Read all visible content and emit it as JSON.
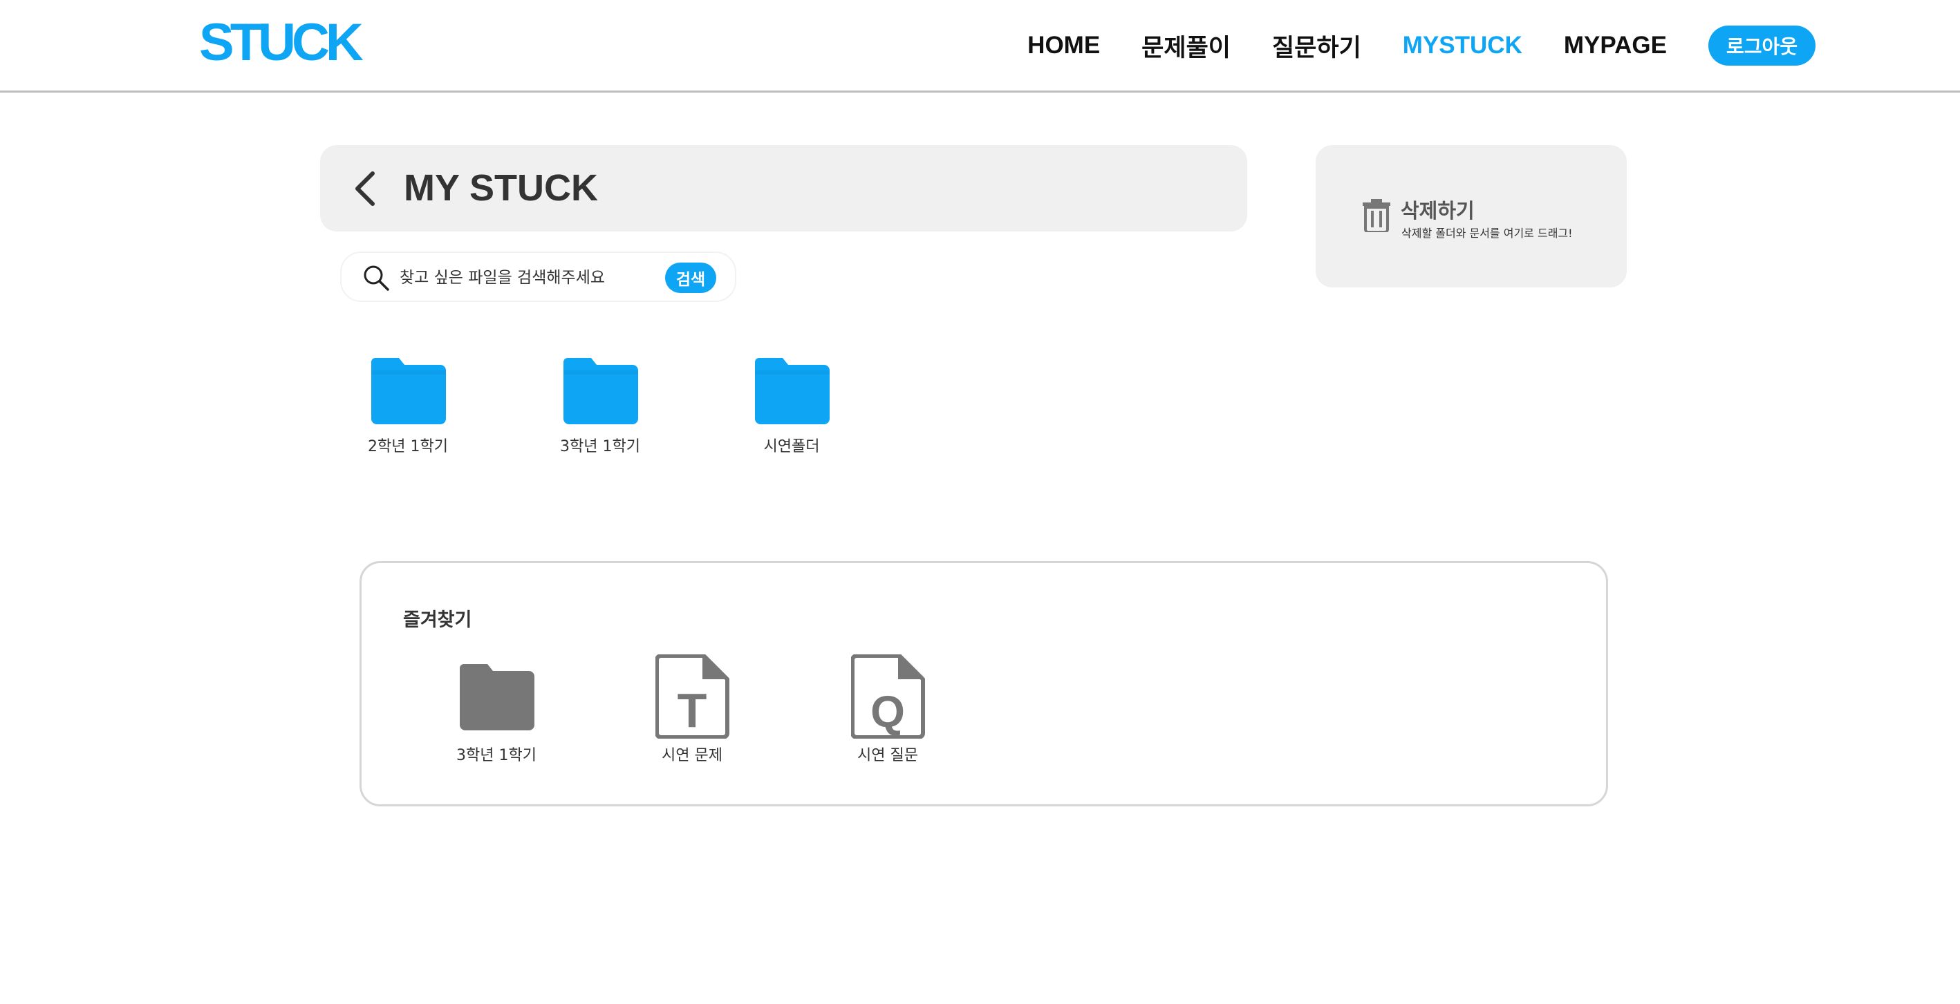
{
  "header": {
    "logo": "STUCK",
    "nav": [
      {
        "label": "HOME",
        "active": false
      },
      {
        "label": "문제풀이",
        "active": false
      },
      {
        "label": "질문하기",
        "active": false
      },
      {
        "label": "MYSTUCK",
        "active": true
      },
      {
        "label": "MYPAGE",
        "active": false
      }
    ],
    "logout_label": "로그아웃"
  },
  "title_bar": {
    "title": "MY STUCK",
    "back_icon": "chevron-left-icon"
  },
  "search": {
    "placeholder": "찾고 싶은 파일을 검색해주세요",
    "button_label": "검색",
    "icon": "search-icon"
  },
  "delete_zone": {
    "icon": "trash-icon",
    "title": "삭제하기",
    "description": "삭제할 폴더와 문서를 여기로 드래그!"
  },
  "folders": [
    {
      "label": "2학년 1학기",
      "icon": "folder-icon"
    },
    {
      "label": "3학년 1학기",
      "icon": "folder-icon"
    },
    {
      "label": "시연폴더",
      "icon": "folder-icon"
    }
  ],
  "favorites": {
    "title": "즐겨찾기",
    "items": [
      {
        "label": "3학년 1학기",
        "icon": "folder-icon"
      },
      {
        "label": "시연 문제",
        "icon": "document-t-icon",
        "letter": "T"
      },
      {
        "label": "시연 질문",
        "icon": "document-q-icon",
        "letter": "Q"
      }
    ]
  },
  "colors": {
    "accent": "#0ea5f5",
    "panel_bg": "#f0f0f0",
    "favorite_icon": "#777777",
    "text_dark": "#333333"
  }
}
